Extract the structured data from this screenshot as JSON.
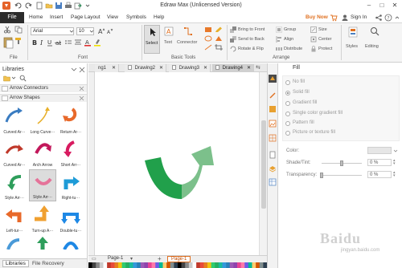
{
  "window": {
    "title": "Edraw Max (Unlicensed Version)",
    "controls": [
      "–",
      "□",
      "✕"
    ]
  },
  "menubar": {
    "file": "File",
    "items": [
      "Home",
      "Insert",
      "Page Layout",
      "View",
      "Symbols",
      "Help"
    ],
    "buy_now": "Buy Now",
    "sign_in": "Sign In"
  },
  "ribbon": {
    "font_name": "Arial",
    "font_size": "10",
    "file_label": "File",
    "font_label": "Font",
    "basic_tools_label": "Basic Tools",
    "arrange_label": "Arrange",
    "select_label": "Select",
    "text_label": "Text",
    "connector_label": "Connector",
    "bring_to_front": "Bring to Front",
    "send_to_back": "Send to Back",
    "rotate_flip": "Rotate & Flip",
    "group": "Group",
    "align": "Align",
    "distribute": "Distribute",
    "size": "Size",
    "center": "Center",
    "protect": "Protect",
    "styles": "Styles",
    "editing": "Editing"
  },
  "libraries": {
    "title": "Libraries",
    "sections": [
      "Arrow Connectors",
      "Arrow Shapes"
    ],
    "shapes": [
      {
        "label": "Curved Ar···",
        "icon": "curved-arrow-blue",
        "color": "#3a7cc1"
      },
      {
        "label": "Long Curve···",
        "icon": "long-curve-arrow",
        "color": "#e8b02a"
      },
      {
        "label": "Return Ar···",
        "icon": "return-arrow",
        "color": "#e8692a"
      },
      {
        "label": "Curved Ar···",
        "icon": "curved-arrow-red",
        "color": "#c0392b"
      },
      {
        "label": "Arch Arrow",
        "icon": "arch-arrow",
        "color": "#c2185b"
      },
      {
        "label": "Short Arr···",
        "icon": "short-arrow",
        "color": "#d81b60"
      },
      {
        "label": "Style Arr···",
        "icon": "style-arrow-green",
        "color": "#2e9e5b"
      },
      {
        "label": "Style Arr···",
        "icon": "style-arrow-pink",
        "color": "#e57399"
      },
      {
        "label": "Right-tu···",
        "icon": "right-turn-arrow",
        "color": "#1e9bd7"
      },
      {
        "label": "Left-tur···",
        "icon": "left-turn-arrow",
        "color": "#e8692a"
      },
      {
        "label": "Turn-up A···",
        "icon": "turn-up-arrow",
        "color": "#f0a030"
      },
      {
        "label": "Double-tu···",
        "icon": "double-turn-arrow",
        "color": "#1e88e5"
      }
    ],
    "footer_tabs": [
      "Libraries",
      "File Recovery"
    ]
  },
  "doc_tabs": [
    "ng1",
    "Drawing2",
    "Drawing3",
    "Drawing4"
  ],
  "page_tabs": {
    "left": "Page-1",
    "active": "Page-1"
  },
  "fill_panel": {
    "title": "Fill",
    "options": [
      "No fill",
      "Solid fill",
      "Gradient fill",
      "Single color gradient fill",
      "Pattern fill",
      "Picture or texture fill"
    ],
    "selected_index": 1,
    "color_label": "Color:",
    "shade_label": "Shade/Tint:",
    "shade_value": "0 %",
    "transparency_label": "Transparency:",
    "transparency_value": "0 %"
  },
  "watermark": {
    "text": "Baidu",
    "sub": "jingyan.baidu.com"
  },
  "colors": {
    "arrow_dark": "#21a04b",
    "arrow_light": "#7cc08b",
    "accent_orange": "#e07020",
    "file_tab": "#2b2b2b"
  }
}
